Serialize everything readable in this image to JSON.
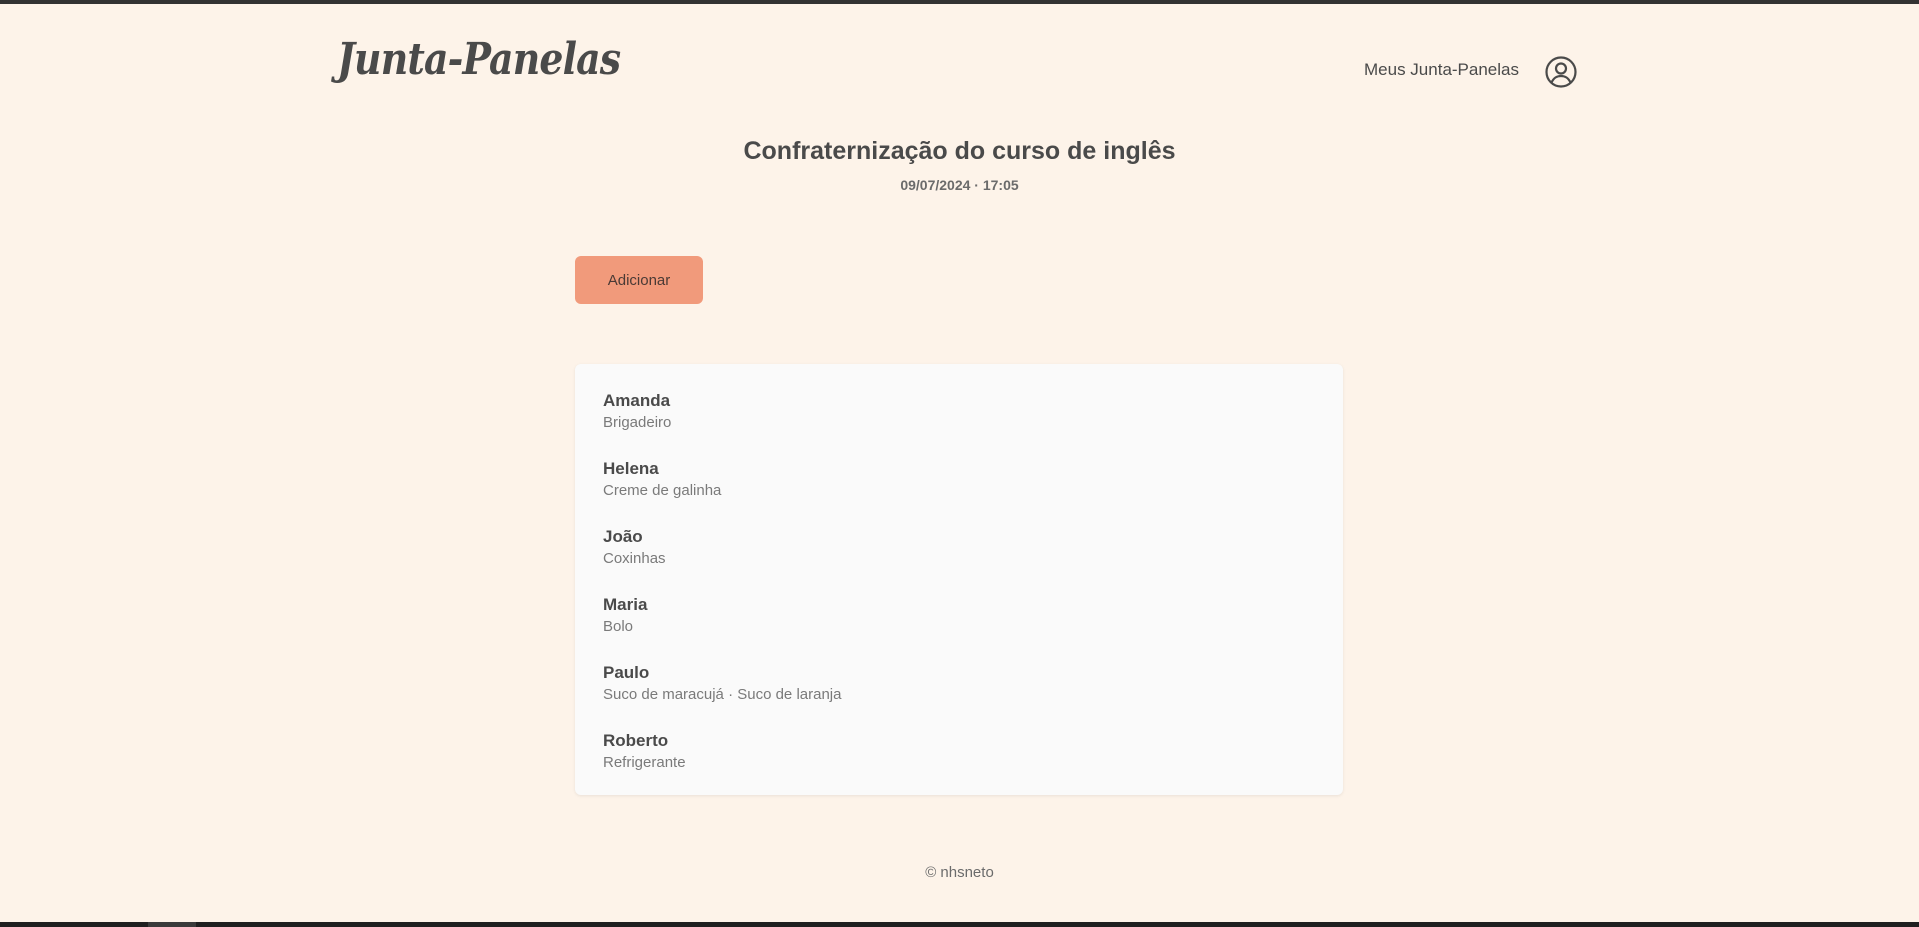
{
  "header": {
    "logo": "Junta-Panelas",
    "nav_link": "Meus Junta-Panelas",
    "account_icon": "user-circle-icon"
  },
  "event": {
    "title": "Confraternização do curso de inglês",
    "datetime": "09/07/2024 · 17:05"
  },
  "actions": {
    "add_label": "Adicionar"
  },
  "participants": [
    {
      "name": "Amanda",
      "dishes": "Brigadeiro"
    },
    {
      "name": "Helena",
      "dishes": "Creme de galinha"
    },
    {
      "name": "João",
      "dishes": "Coxinhas"
    },
    {
      "name": "Maria",
      "dishes": "Bolo"
    },
    {
      "name": "Paulo",
      "dishes": "Suco de maracujá · Suco de laranja"
    },
    {
      "name": "Roberto",
      "dishes": "Refrigerante"
    }
  ],
  "footer": {
    "text": "© nhsneto"
  },
  "colors": {
    "background": "#fdf3e9",
    "accent": "#f19a7b",
    "card": "#fafafa",
    "text": "#4a4a4a"
  }
}
